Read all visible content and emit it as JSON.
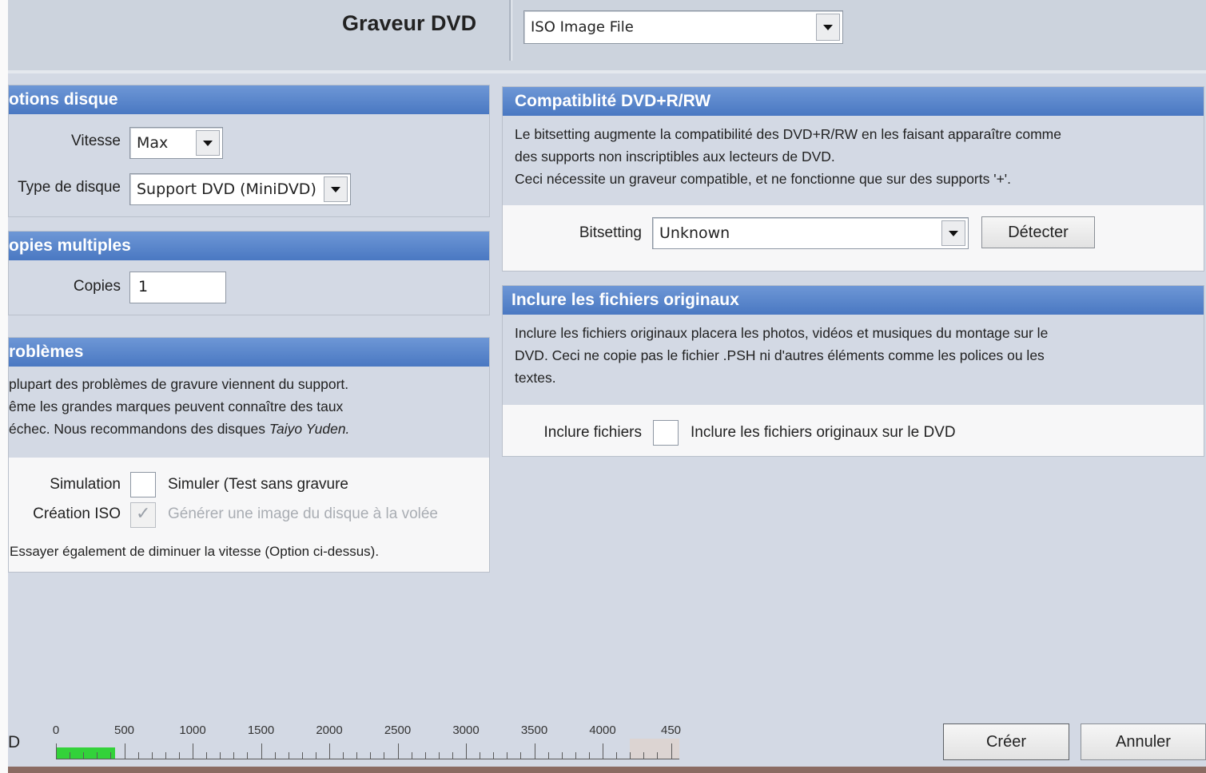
{
  "header": {
    "title": "Graveur DVD",
    "device_value": "ISO Image File"
  },
  "options_disque": {
    "title": "otions disque",
    "vitesse_label": "Vitesse",
    "vitesse_value": "Max",
    "type_label": "Type de disque",
    "type_value": "Support DVD (MiniDVD)"
  },
  "copies": {
    "title": "opies multiples",
    "label": "Copies",
    "value": "1"
  },
  "problemes": {
    "title": "roblèmes",
    "line1": "plupart des problèmes de gravure viennent du support.",
    "line2": "ême les grandes marques peuvent connaître des taux",
    "line3_pre": "échec. Nous recommandons des disques ",
    "line3_brand": "Taiyo Yuden.",
    "simulation_label": "Simulation",
    "simulation_text": "Simuler (Test sans gravure",
    "iso_label": "Création ISO",
    "iso_text": "Générer une image du disque à la volée",
    "tip": "Essayer également de diminuer la vitesse (Option ci-dessus)."
  },
  "compat": {
    "title": "Compatiblité DVD+R/RW",
    "line1": "Le bitsetting augmente la compatibilité des DVD+R/RW en les faisant apparaître comme",
    "line2": "des supports non inscriptibles aux lecteurs de DVD.",
    "line3": "Ceci nécessite un graveur compatible, et ne fonctionne que sur des supports '+'.",
    "bitsetting_label": "Bitsetting",
    "bitsetting_value": "Unknown",
    "detect_label": "Détecter"
  },
  "originaux": {
    "title": "Inclure les fichiers originaux",
    "line1": "Inclure les fichiers originaux placera les photos, vidéos et musiques du montage sur le",
    "line2": "DVD. Ceci ne copie pas le fichier .PSH ni d'autres éléments comme les polices ou les",
    "line3": "textes.",
    "label": "Inclure fichiers",
    "text": "Inclure les fichiers originaux sur le DVD"
  },
  "footer": {
    "left_label": "D",
    "ruler_ticks": [
      "0",
      "500",
      "1000",
      "1500",
      "2000",
      "2500",
      "3000",
      "3500",
      "4000",
      "450"
    ],
    "used_mb": 430,
    "capacity_mb": 4200,
    "create_label": "Créer",
    "cancel_label": "Annuler"
  }
}
